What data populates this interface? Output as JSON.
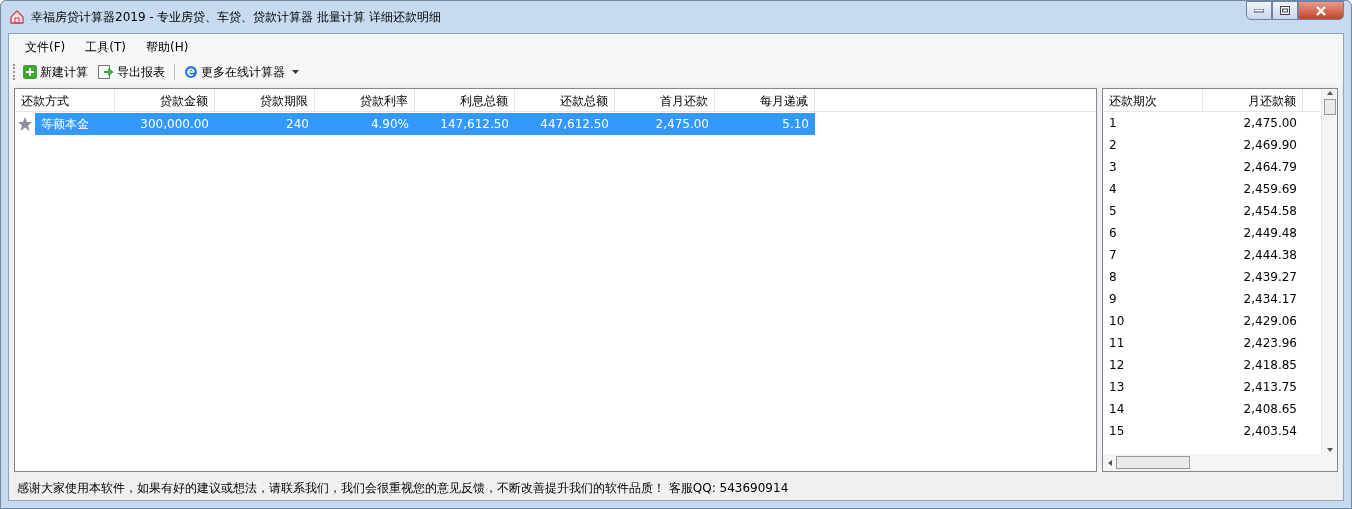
{
  "window": {
    "title": "幸福房贷计算器2019 - 专业房贷、车贷、贷款计算器 批量计算 详细还款明细"
  },
  "menu": [
    "文件(F)",
    "工具(T)",
    "帮助(H)"
  ],
  "toolbar": [
    {
      "kind": "new",
      "label": "新建计算"
    },
    {
      "kind": "export",
      "label": "导出报表"
    },
    {
      "kind": "online",
      "label": "更多在线计算器"
    }
  ],
  "table": {
    "columns": [
      "还款方式",
      "贷款金额",
      "贷款期限",
      "贷款利率",
      "利息总额",
      "还款总额",
      "首月还款",
      "每月递减"
    ],
    "rows": [
      {
        "selected": true,
        "cells": [
          "等额本金",
          "300,000.00",
          "240",
          "4.90%",
          "147,612.50",
          "447,612.50",
          "2,475.00",
          "5.10"
        ]
      }
    ]
  },
  "schedule": {
    "columns": [
      "还款期次",
      "月还款额"
    ],
    "rows": [
      [
        "1",
        "2,475.00"
      ],
      [
        "2",
        "2,469.90"
      ],
      [
        "3",
        "2,464.79"
      ],
      [
        "4",
        "2,459.69"
      ],
      [
        "5",
        "2,454.58"
      ],
      [
        "6",
        "2,449.48"
      ],
      [
        "7",
        "2,444.38"
      ],
      [
        "8",
        "2,439.27"
      ],
      [
        "9",
        "2,434.17"
      ],
      [
        "10",
        "2,429.06"
      ],
      [
        "11",
        "2,423.96"
      ],
      [
        "12",
        "2,418.85"
      ],
      [
        "13",
        "2,413.75"
      ],
      [
        "14",
        "2,408.65"
      ],
      [
        "15",
        "2,403.54"
      ]
    ]
  },
  "status_bar": "感谢大家使用本软件，如果有好的建议或想法，请联系我们，我们会很重视您的意见反馈，不断改善提升我们的软件品质！ 客服QQ: 543690914"
}
